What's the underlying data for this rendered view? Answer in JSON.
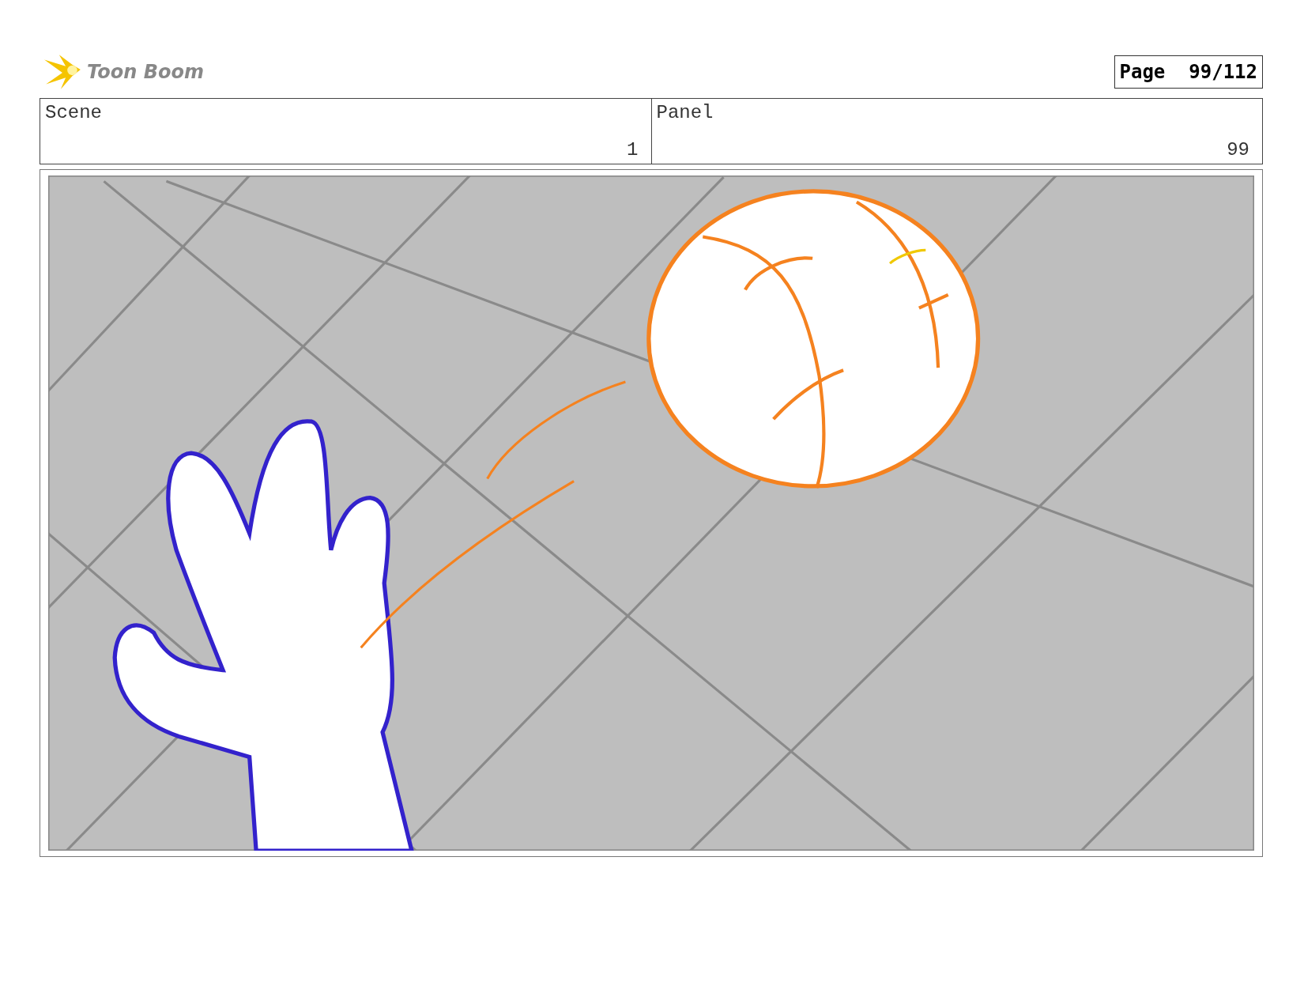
{
  "header": {
    "logo_text": "Toon Boom",
    "page_label": "Page",
    "page_number": "99/112"
  },
  "info": [
    {
      "label": "Scene",
      "value": "1"
    },
    {
      "label": "Panel",
      "value": "99"
    }
  ]
}
